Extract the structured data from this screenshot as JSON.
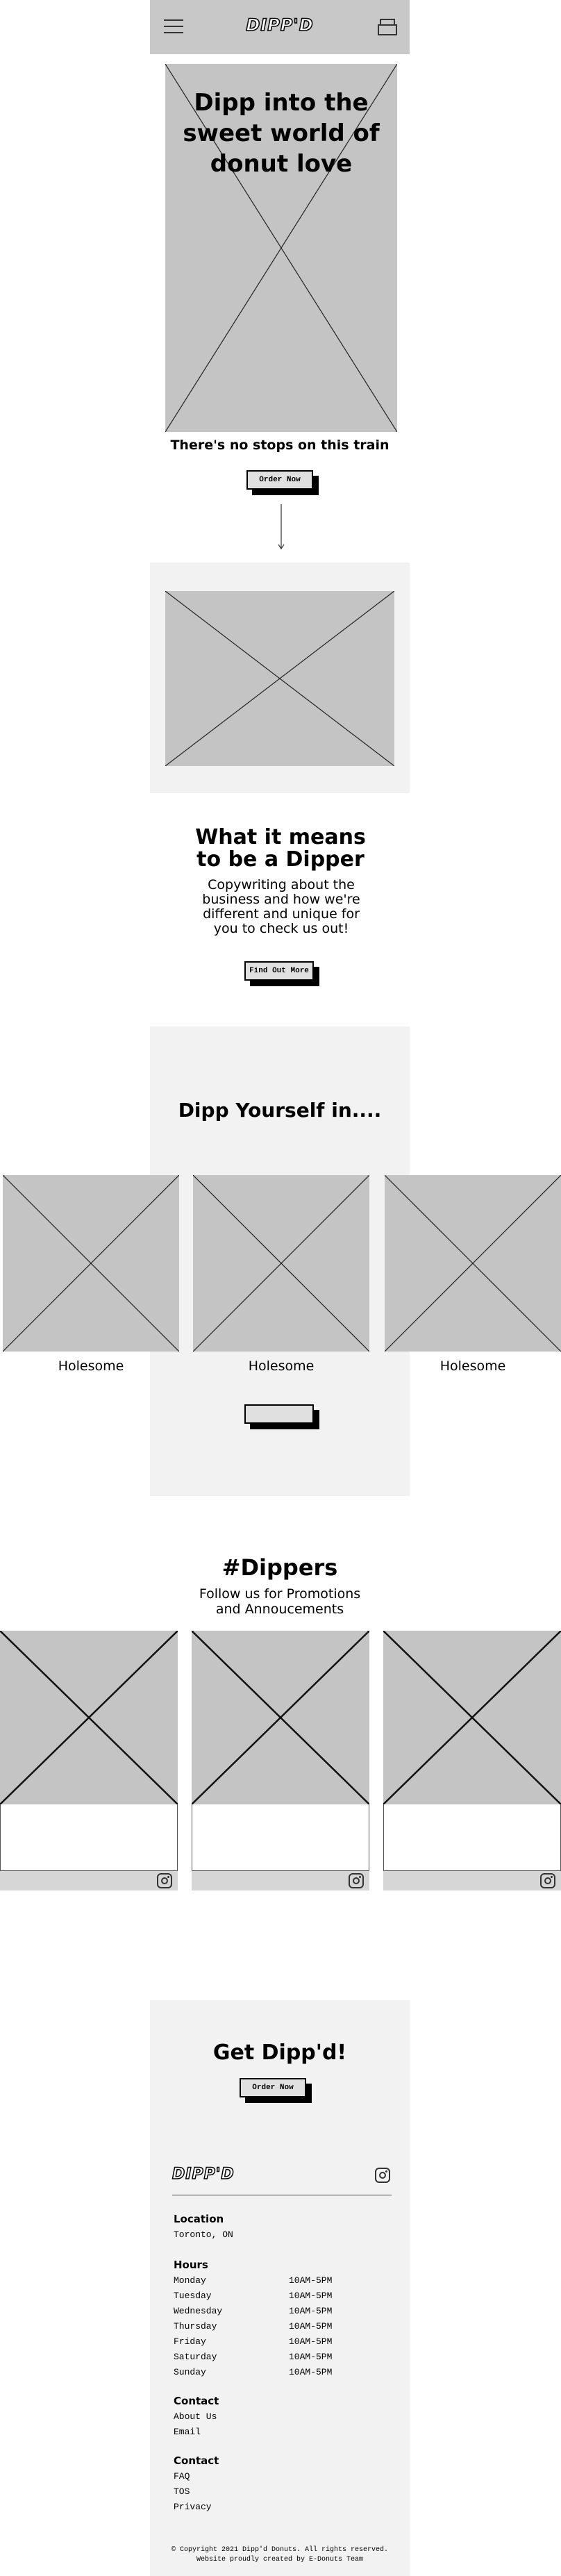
{
  "header": {
    "logo": "DIPP'D",
    "menu_icon": "hamburger-menu-icon",
    "cart_icon": "donut-box-icon"
  },
  "hero": {
    "title": "Dipp into the sweet world of donut love",
    "subtitle": "There's no stops on this train",
    "cta": "Order Now",
    "scroll_icon": "arrow-down-icon"
  },
  "about": {
    "title": "What it means to be a Dipper",
    "body": "Copywriting about the business and how we're different and unique for you to check us out!",
    "cta": "Find Out More"
  },
  "flavours": {
    "title": "Dipp Yourself in....",
    "items": [
      {
        "label": "Holesome"
      },
      {
        "label": "Holesome"
      },
      {
        "label": "Holesome"
      }
    ],
    "cta": ""
  },
  "social": {
    "title": "#Dippers",
    "subtitle": "Follow us for Promotions and Annoucements",
    "icon": "instagram-icon"
  },
  "get": {
    "title": "Get Dipp'd!",
    "cta": "Order Now"
  },
  "footer": {
    "logo": "DIPP'D",
    "location_heading": "Location",
    "location": "Toronto, ON",
    "hours_heading": "Hours",
    "hours": [
      {
        "day": "Monday",
        "time": "10AM-5PM"
      },
      {
        "day": "Tuesday",
        "time": "10AM-5PM"
      },
      {
        "day": "Wednesday",
        "time": "10AM-5PM"
      },
      {
        "day": "Thursday",
        "time": "10AM-5PM"
      },
      {
        "day": "Friday",
        "time": "10AM-5PM"
      },
      {
        "day": "Saturday",
        "time": "10AM-5PM"
      },
      {
        "day": "Sunday",
        "time": "10AM-5PM"
      }
    ],
    "contact_heading": "Contact",
    "contact_links": [
      "About Us",
      "Email"
    ],
    "contact2_heading": "Contact",
    "contact2_links": [
      "FAQ",
      "TOS",
      "Privacy"
    ],
    "copyright": "© Copyright 2021 Dipp'd Donuts. All rights reserved.",
    "credit": "Website proudly created by E-Donuts Team"
  }
}
